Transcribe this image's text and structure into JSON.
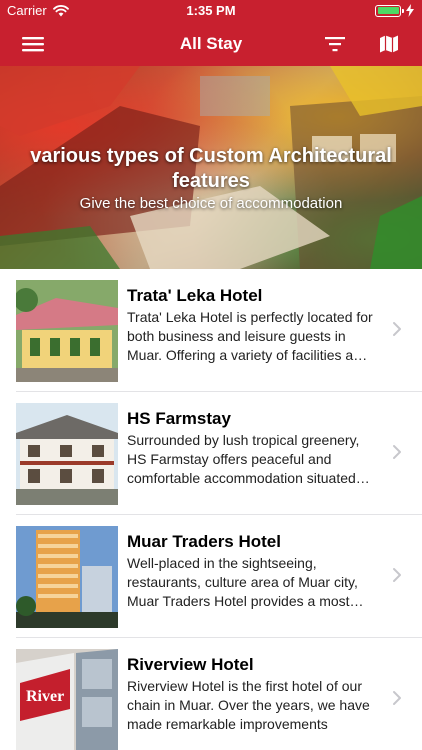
{
  "status_bar": {
    "carrier": "Carrier",
    "time": "1:35 PM"
  },
  "nav": {
    "title": "All Stay",
    "icons": {
      "menu": "hamburger-menu-icon",
      "filter": "filter-icon",
      "map": "map-icon"
    }
  },
  "banner": {
    "title": "various types of Custom Architectural features",
    "subtitle": "Give the best choice of accommodation"
  },
  "hotels": [
    {
      "name": "Trata' Leka Hotel",
      "description": "Trata' Leka Hotel is perfectly located for both business and leisure guests in Muar. Offering a variety of facilities and services"
    },
    {
      "name": "HS Farmstay",
      "description": "Surrounded by lush tropical greenery, HS Farmstay offers peaceful and comfortable accommodation situated close to town"
    },
    {
      "name": "Muar Traders Hotel",
      "description": "Well-placed in the sightseeing, restaurants, culture area of Muar city, Muar Traders Hotel provides a most convenient stay"
    },
    {
      "name": "Riverview Hotel",
      "description": "Riverview Hotel is the first hotel of our chain in Muar. Over the years, we have made remarkable improvements"
    }
  ],
  "colors": {
    "brand": "#c8202f",
    "separator": "#e3e3e6",
    "chevron": "#c7c7cc",
    "battery": "#4cd964"
  }
}
